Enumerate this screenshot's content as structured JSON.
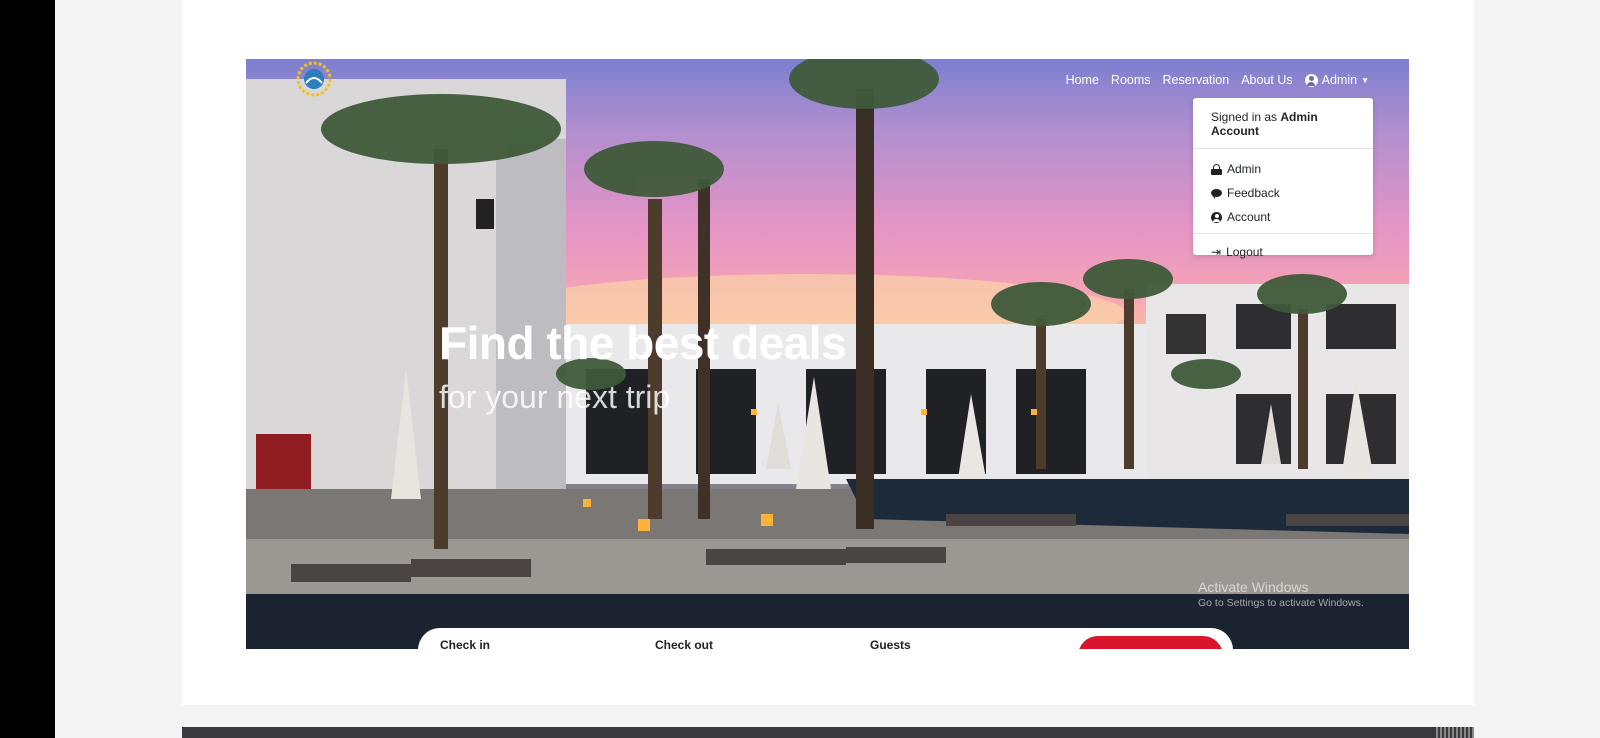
{
  "nav": {
    "links": [
      "Home",
      "Rooms",
      "Reservation",
      "About Us"
    ],
    "admin_label": "Admin"
  },
  "dropdown": {
    "signed_in_prefix": "Signed in as",
    "signed_in_user": "Admin Account",
    "items": [
      {
        "label": "Admin",
        "icon": "lock-icon"
      },
      {
        "label": "Feedback",
        "icon": "comment-icon"
      },
      {
        "label": "Account",
        "icon": "user-circle-icon"
      }
    ],
    "logout_label": "Logout"
  },
  "hero": {
    "headline": "Find the best deals",
    "subline": "for your next trip"
  },
  "search": {
    "check_in_label": "Check in",
    "check_out_label": "Check out",
    "guests_label": "Guests",
    "button_color": "#d9152c"
  },
  "watermark": {
    "line1": "Activate Windows",
    "line2": "Go to Settings to activate Windows."
  }
}
